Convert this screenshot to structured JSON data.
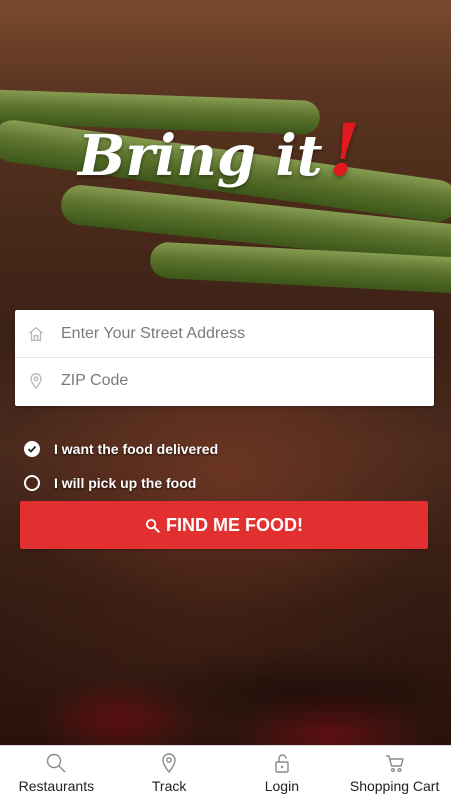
{
  "app": {
    "logo_text": "Bring it",
    "logo_accent": "!"
  },
  "form": {
    "address": {
      "placeholder": "Enter Your Street Address",
      "value": "",
      "icon": "home-icon"
    },
    "zip": {
      "placeholder": "ZIP Code",
      "value": "",
      "icon": "location-pin-icon"
    },
    "options": [
      {
        "label": "I want the food delivered",
        "checked": true
      },
      {
        "label": "I will pick up the food",
        "checked": false
      }
    ],
    "submit_label": "FIND ME FOOD!"
  },
  "tabs": [
    {
      "label": "Restaurants",
      "icon": "search-icon"
    },
    {
      "label": "Track",
      "icon": "location-pin-icon"
    },
    {
      "label": "Login",
      "icon": "unlock-icon"
    },
    {
      "label": "Shopping Cart",
      "icon": "cart-icon"
    }
  ],
  "colors": {
    "accent": "#e23030",
    "logo_bang": "#e0191f"
  }
}
